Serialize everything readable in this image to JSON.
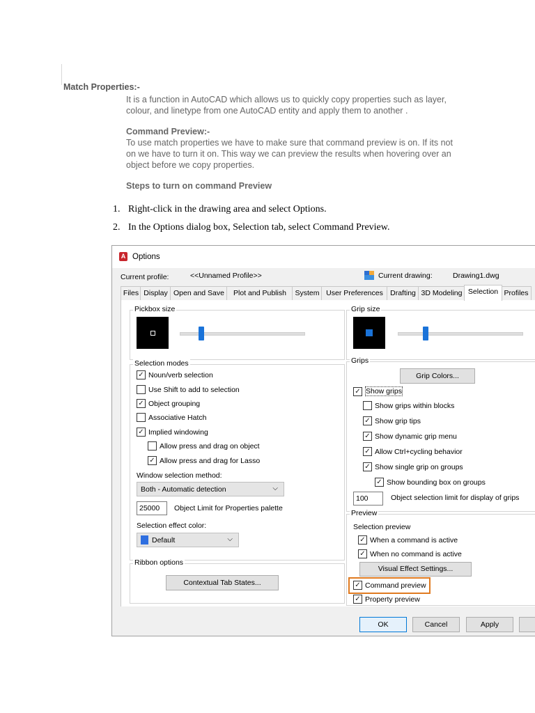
{
  "doc": {
    "heading": "Match Properties:-",
    "intro": [
      "It is a function in AutoCAD which allows us to quickly copy properties such as layer,",
      "colour, and linetype from one AutoCAD entity and apply them to another ."
    ],
    "preview_heading": "Command Preview:-",
    "preview_text": [
      "To use match properties we have to make sure that command preview is on. If its not",
      "on we have to turn it on. This way we can preview the results when hovering over an",
      "object before we copy properties."
    ],
    "steps_heading": "Steps to turn on command Preview",
    "steps": [
      {
        "num": "1.",
        "text": "Right-click in the drawing area and select Options."
      },
      {
        "num": "2.",
        "text": "In the Options dialog box, Selection tab, select Command Preview."
      }
    ]
  },
  "dialog": {
    "title": "Options",
    "app_icon": "A",
    "current_profile_label": "Current profile:",
    "current_profile_value": "<<Unnamed Profile>>",
    "current_drawing_label": "Current drawing:",
    "current_drawing_value": "Drawing1.dwg",
    "tabs": [
      "Files",
      "Display",
      "Open and Save",
      "Plot and Publish",
      "System",
      "User Preferences",
      "Drafting",
      "3D Modeling",
      "Selection",
      "Profiles"
    ],
    "active_tab": "Selection",
    "pickbox_label": "Pickbox size",
    "selection_modes_label": "Selection modes",
    "selection_modes": [
      {
        "label": "Noun/verb selection",
        "checked": true
      },
      {
        "label": "Use Shift to add to selection",
        "checked": false
      },
      {
        "label": "Object grouping",
        "checked": true
      },
      {
        "label": "Associative Hatch",
        "checked": false
      },
      {
        "label": "Implied windowing",
        "checked": true
      },
      {
        "label": "Allow press and drag on object",
        "checked": false
      },
      {
        "label": "Allow press and drag for Lasso",
        "checked": true
      }
    ],
    "window_method_label": "Window selection method:",
    "window_method_value": "Both - Automatic detection",
    "object_limit_value": "25000",
    "object_limit_label": "Object Limit for Properties palette",
    "effect_color_label": "Selection effect color:",
    "effect_color_value": "Default",
    "effect_color_swatch": "#2f6fe0",
    "ribbon_label": "Ribbon options",
    "contextual_button": "Contextual Tab States...",
    "grip_size_label": "Grip size",
    "grips_label": "Grips",
    "grip_colors_button": "Grip Colors...",
    "grips": [
      {
        "label": "Show grips",
        "checked": true
      },
      {
        "label": "Show grips within blocks",
        "checked": false
      },
      {
        "label": "Show grip tips",
        "checked": true
      },
      {
        "label": "Show dynamic grip menu",
        "checked": true
      },
      {
        "label": "Allow Ctrl+cycling behavior",
        "checked": true
      },
      {
        "label": "Show single grip on groups",
        "checked": true
      },
      {
        "label": "Show bounding box on groups",
        "checked": true
      }
    ],
    "grip_limit_value": "100",
    "grip_limit_label": "Object selection limit for display of grips",
    "preview_label": "Preview",
    "selection_preview_label": "Selection preview",
    "previews": [
      {
        "label": "When a command is active",
        "checked": true
      },
      {
        "label": "When no command is active",
        "checked": true
      }
    ],
    "visual_effect_button": "Visual Effect Settings...",
    "command_preview": {
      "label": "Command preview",
      "checked": true
    },
    "property_preview": {
      "label": "Property preview",
      "checked": true
    },
    "ok_button": "OK",
    "cancel_button": "Cancel",
    "apply_button": "Apply",
    "highlight_color": "#e07a1f",
    "accent_color": "#1a73d9"
  }
}
